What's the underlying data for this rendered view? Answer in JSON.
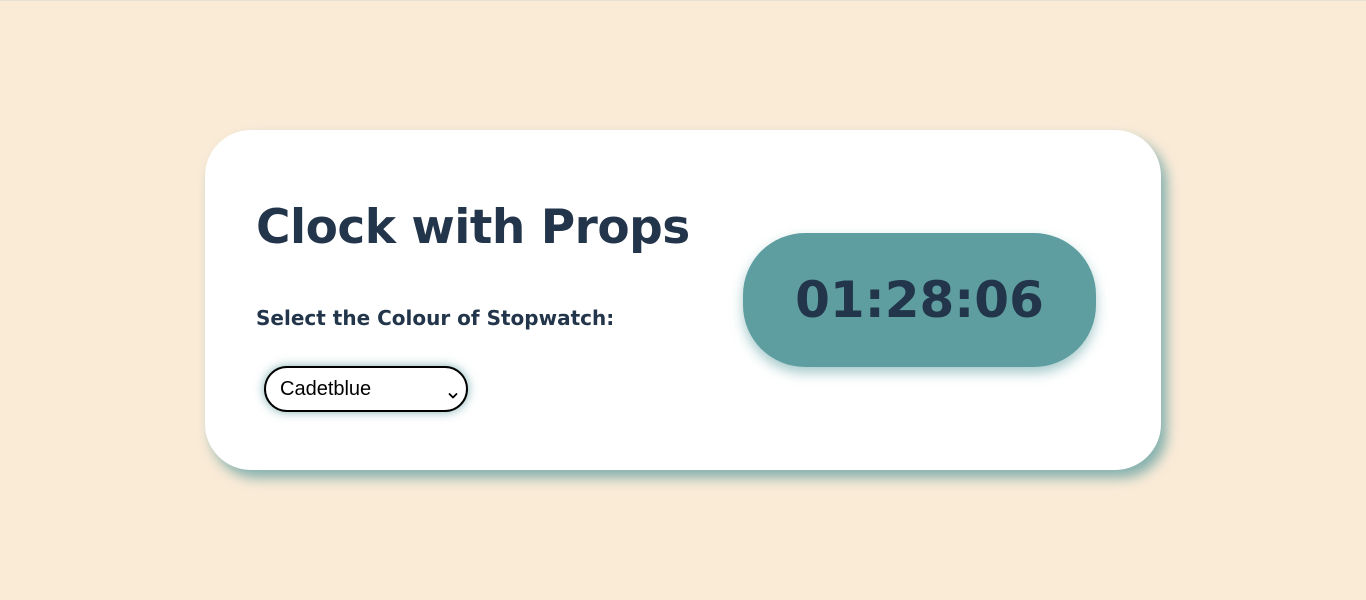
{
  "page": {
    "background_color": "#faebd7"
  },
  "card": {
    "title": "Clock with Props",
    "select_label": "Select the Colour of Stopwatch:",
    "color_select": {
      "selected": "Cadetblue"
    }
  },
  "stopwatch": {
    "time": "01:28:06",
    "color": "#5f9ea0"
  },
  "colors": {
    "text": "#22354a",
    "accent": "#5f9ea0",
    "card": "#ffffff"
  },
  "icons": {
    "select_arrow": "chevron-down-icon"
  }
}
